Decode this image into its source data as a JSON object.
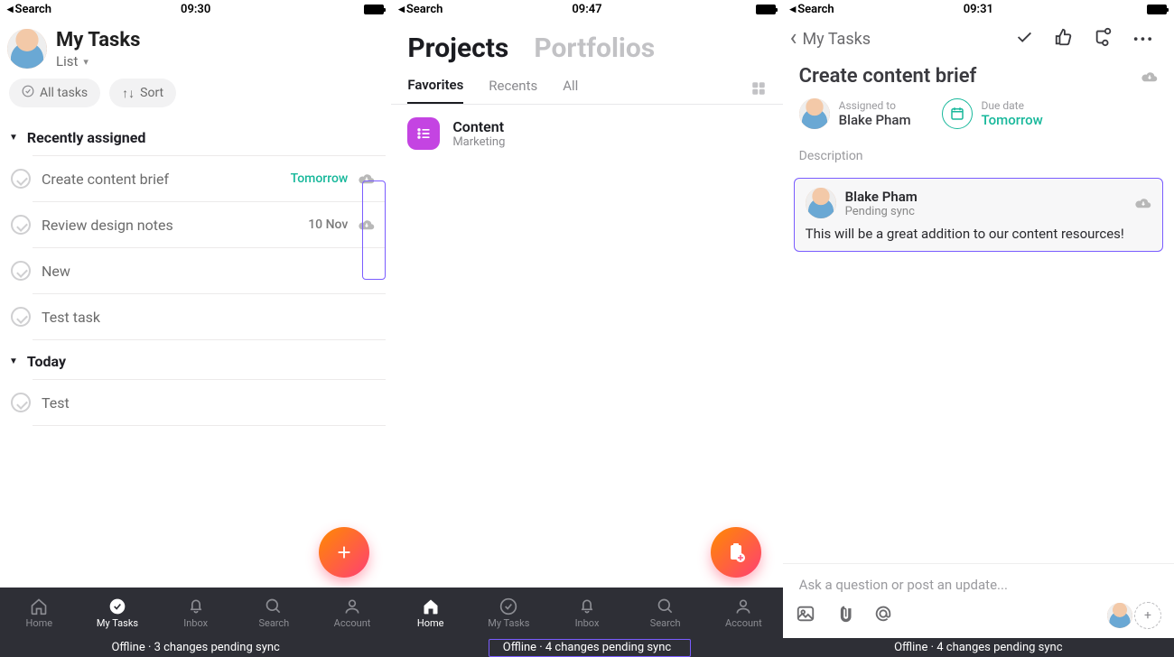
{
  "status": {
    "search": "Search",
    "time1": "09:30",
    "time2": "09:47",
    "time3": "09:31"
  },
  "screen1": {
    "title": "My Tasks",
    "view": "List",
    "allTasks": "All tasks",
    "sort": "Sort",
    "section1": "Recently assigned",
    "tasks": [
      {
        "name": "Create content brief",
        "due": "Tomorrow"
      },
      {
        "name": "Review design notes",
        "due": "10 Nov"
      },
      {
        "name": "New",
        "due": ""
      },
      {
        "name": "Test task",
        "due": ""
      }
    ],
    "section2": "Today",
    "tasks2": [
      {
        "name": "Test",
        "due": ""
      }
    ]
  },
  "tabs": {
    "home": "Home",
    "mytasks": "My Tasks",
    "inbox": "Inbox",
    "search": "Search",
    "account": "Account"
  },
  "offline": {
    "s1": "Offline · 3 changes pending sync",
    "s2": "Offline · 4 changes pending sync",
    "s3": "Offline · 4 changes pending sync"
  },
  "screen2": {
    "tabProjects": "Projects",
    "tabPortfolios": "Portfolios",
    "subFavorites": "Favorites",
    "subRecents": "Recents",
    "subAll": "All",
    "project": {
      "name": "Content",
      "team": "Marketing"
    }
  },
  "screen3": {
    "back": "My Tasks",
    "title": "Create content brief",
    "assignedLabel": "Assigned to",
    "assignedTo": "Blake Pham",
    "dueLabel": "Due date",
    "dueVal": "Tomorrow",
    "description": "Description",
    "comment": {
      "author": "Blake Pham",
      "status": "Pending sync",
      "body": "This will be a great addition to our content resources!"
    },
    "composerPlaceholder": "Ask a question or post an update..."
  }
}
